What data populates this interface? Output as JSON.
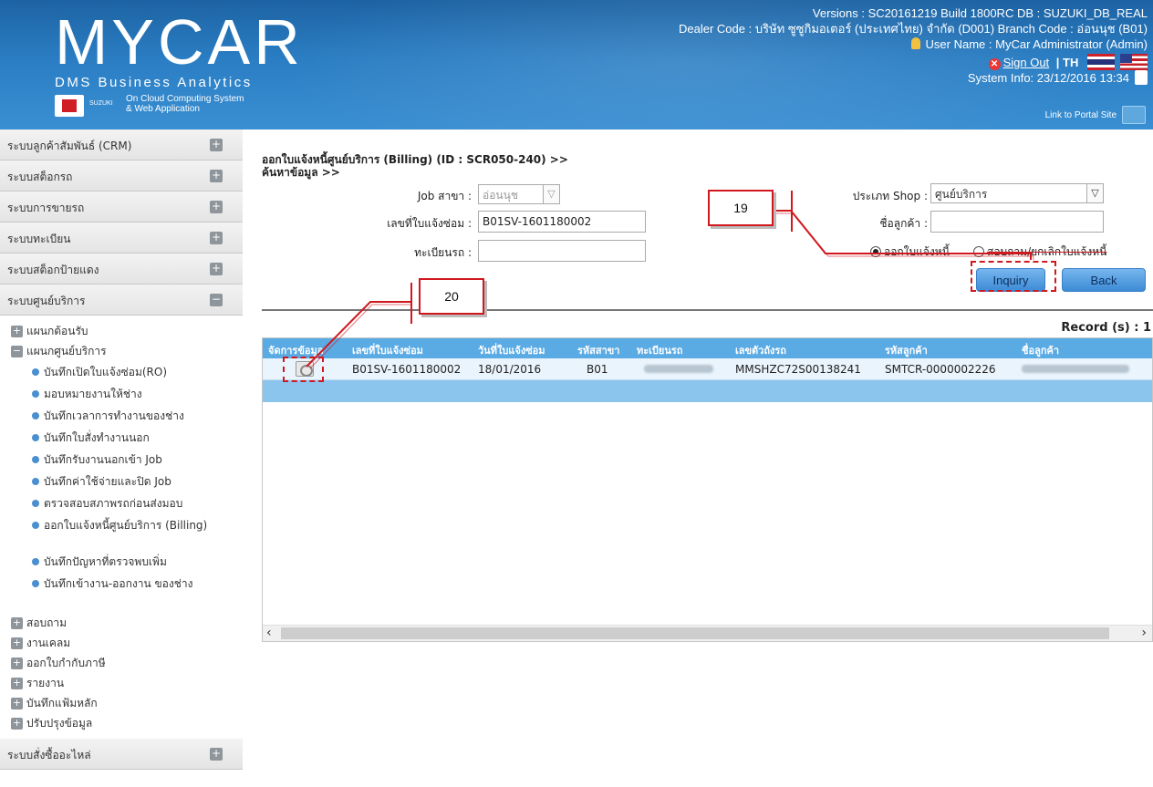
{
  "header": {
    "logo_main": "MYCAR",
    "logo_sub": "DMS Business Analytics",
    "suzuki_label": "SUZUKI",
    "cloud_line1": "On Cloud Computing System",
    "cloud_line2": "& Web Application",
    "versions": "Versions : SC20161219 Build 1800RC DB : SUZUKI_DB_REAL",
    "dealer": "Dealer Code : บริษัท ซูซูกิมอเตอร์ (ประเทศไทย) จำกัด (D001)  Branch Code : อ่อนนุช (B01)",
    "user": "User Name : MyCar Administrator  (Admin)",
    "signout": "Sign Out",
    "lang": "| TH",
    "system_info": "System Info: 23/12/2016 13:34",
    "portal": "Link to Portal Site"
  },
  "sidebar": {
    "groups_top": [
      {
        "label": "ระบบลูกค้าสัมพันธ์ (CRM)",
        "toggle": "+"
      },
      {
        "label": "ระบบสต็อกรถ",
        "toggle": "+"
      },
      {
        "label": "ระบบการขายรถ",
        "toggle": "+"
      },
      {
        "label": "ระบบทะเบียน",
        "toggle": "+"
      },
      {
        "label": "ระบบสต็อกป้ายแดง",
        "toggle": "+"
      },
      {
        "label": "ระบบศูนย์บริการ",
        "toggle": "−"
      }
    ],
    "sub_reception": {
      "label": "แผนกต้อนรับ",
      "toggle": "+"
    },
    "sub_service": {
      "label": "แผนกศูนย์บริการ",
      "toggle": "−"
    },
    "leaves": [
      "บันทึกเปิดใบแจ้งซ่อม(RO)",
      "มอบหมายงานให้ช่าง",
      "บันทึกเวลาการทำงานของช่าง",
      "บันทึกใบสั่งทำงานนอก",
      "บันทึกรับงานนอกเข้า Job",
      "บันทึกค่าใช้จ่ายและปิด Job",
      "ตรวจสอบสภาพรถก่อนส่งมอบ",
      "ออกใบแจ้งหนี้ศูนย์บริการ (Billing)",
      "บันทึกปัญหาที่ตรวจพบเพิ่ม",
      "บันทึกเข้างาน-ออกงาน ของช่าง"
    ],
    "subs_bottom": [
      {
        "label": "สอบถาม",
        "toggle": "+"
      },
      {
        "label": "งานเคลม",
        "toggle": "+"
      },
      {
        "label": "ออกใบกำกับภาษี",
        "toggle": "+"
      },
      {
        "label": "รายงาน",
        "toggle": "+"
      },
      {
        "label": "บันทึกแฟ้มหลัก",
        "toggle": "+"
      },
      {
        "label": "ปรับปรุงข้อมูล",
        "toggle": "+"
      }
    ],
    "group_bottom": {
      "label": "ระบบสั่งซื้ออะไหล่",
      "toggle": "+"
    }
  },
  "main": {
    "title_line1": "ออกใบแจ้งหนี้ศูนย์บริการ (Billing) (ID : SCR050-240) >>",
    "title_line2": "ค้นหาข้อมูล >>",
    "job_branch_label": "Job สาขา :",
    "job_branch_value": "อ่อนนุช",
    "repair_no_label": "เลขที่ใบแจ้งซ่อม :",
    "repair_no_value": "B01SV-1601180002",
    "plate_label": "ทะเบียนรถ :",
    "plate_value": "",
    "shop_type_label": "ประเภท Shop :",
    "shop_type_value": "ศูนย์บริการ",
    "customer_label": "ชื่อลูกค้า :",
    "customer_value": "",
    "radio_issue": "ออกใบแจ้งหนี้",
    "radio_query": "สอบถาม/ยกเลิกใบแจ้งหนี้",
    "inquiry": "Inquiry",
    "back": "Back",
    "record": "Record (s) : 1"
  },
  "grid": {
    "columns": [
      "จัดการข้อมูล",
      "เลขที่ใบแจ้งซ่อม",
      "วันที่ใบแจ้งซ่อม",
      "รหัสสาขา",
      "ทะเบียนรถ",
      "เลขตัวถังรถ",
      "รหัสลูกค้า",
      "ชื่อลูกค้า"
    ],
    "rows": [
      {
        "ro_no": "B01SV-1601180002",
        "ro_date": "18/01/2016",
        "branch": "B01",
        "chassis": "MMSHZC72S00138241",
        "cust_code": "SMTCR-0000002226"
      }
    ]
  },
  "annotations": {
    "callout_19": "19",
    "callout_20": "20"
  },
  "colors": {
    "header_blue": "#2a7dc3",
    "grid_header": "#5aaae4",
    "annotation_red": "#d0181e"
  }
}
